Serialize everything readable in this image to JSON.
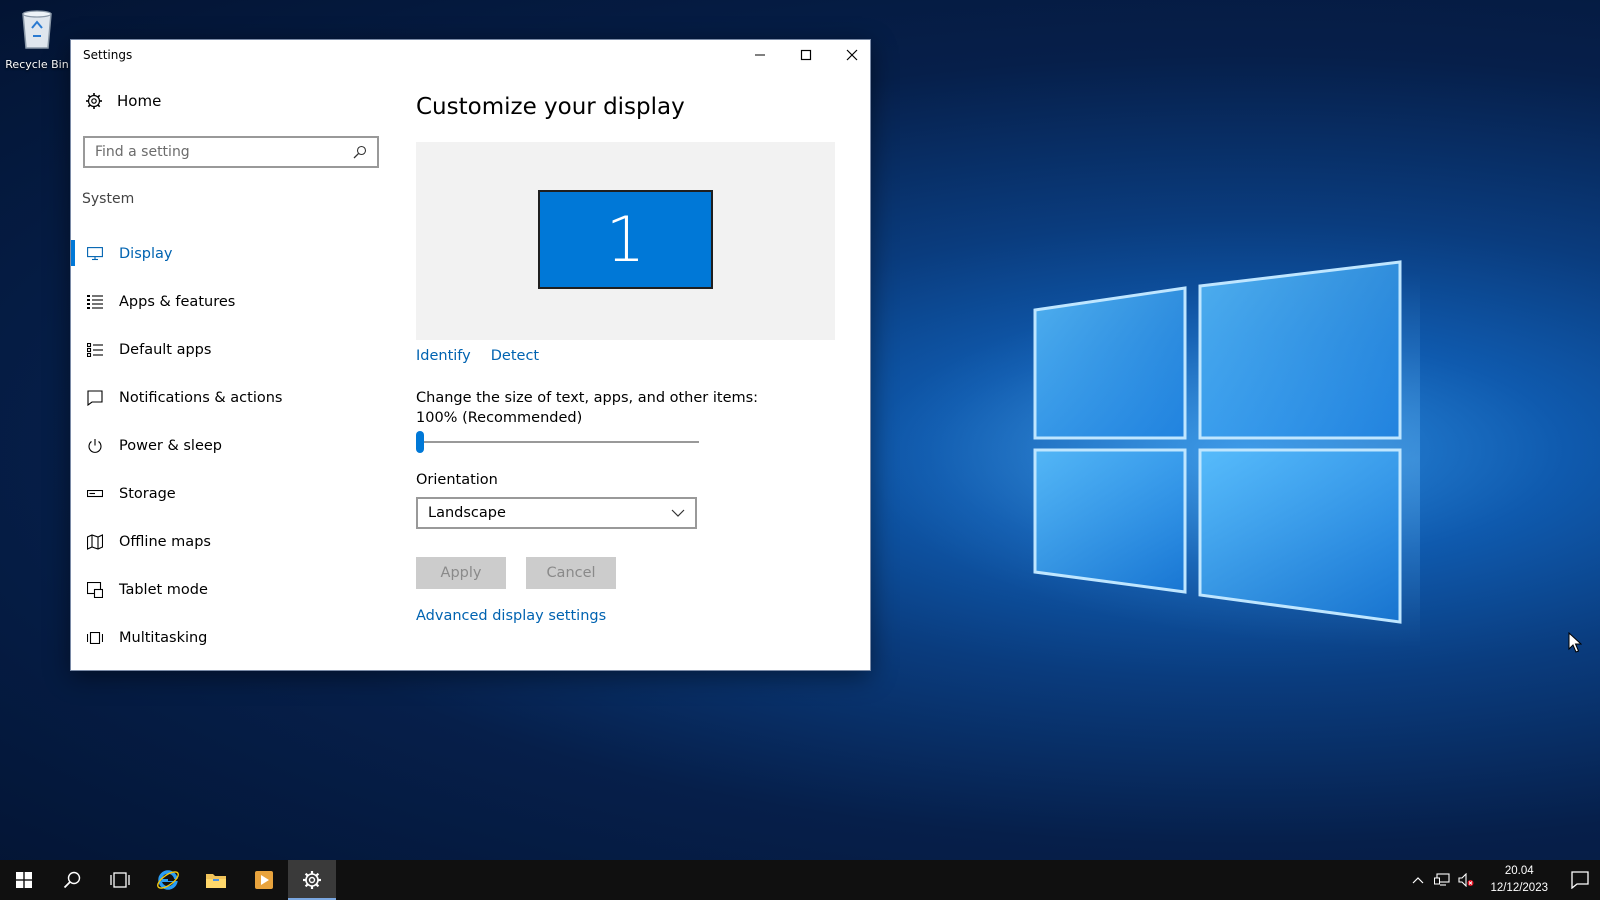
{
  "desktop": {
    "recycle_bin_label": "Recycle Bin"
  },
  "window": {
    "title": "Settings",
    "controls": [
      "minimize-icon",
      "maximize-icon",
      "close-icon"
    ]
  },
  "nav": {
    "home_label": "Home",
    "search_placeholder": "Find a setting",
    "section_label": "System",
    "items": [
      {
        "label": "Display",
        "icon": "monitor-icon",
        "active": true
      },
      {
        "label": "Apps & features",
        "icon": "list-icon"
      },
      {
        "label": "Default apps",
        "icon": "default-apps-icon"
      },
      {
        "label": "Notifications & actions",
        "icon": "notification-icon"
      },
      {
        "label": "Power & sleep",
        "icon": "power-icon"
      },
      {
        "label": "Storage",
        "icon": "storage-icon"
      },
      {
        "label": "Offline maps",
        "icon": "map-icon"
      },
      {
        "label": "Tablet mode",
        "icon": "tablet-icon"
      },
      {
        "label": "Multitasking",
        "icon": "multitasking-icon"
      }
    ]
  },
  "main": {
    "heading": "Customize your display",
    "monitor_number": "1",
    "identify_label": "Identify",
    "detect_label": "Detect",
    "scale_label": "Change the size of text, apps, and other items: 100% (Recommended)",
    "scale_value": 0,
    "orientation_label": "Orientation",
    "orientation_value": "Landscape",
    "apply_label": "Apply",
    "cancel_label": "Cancel",
    "advanced_link": "Advanced display settings"
  },
  "taskbar": {
    "time": "20.04",
    "date": "12/12/2023",
    "active_app": "settings"
  },
  "colors": {
    "accent": "#0078d7",
    "link": "#0063b1",
    "taskbar": "#101010"
  }
}
